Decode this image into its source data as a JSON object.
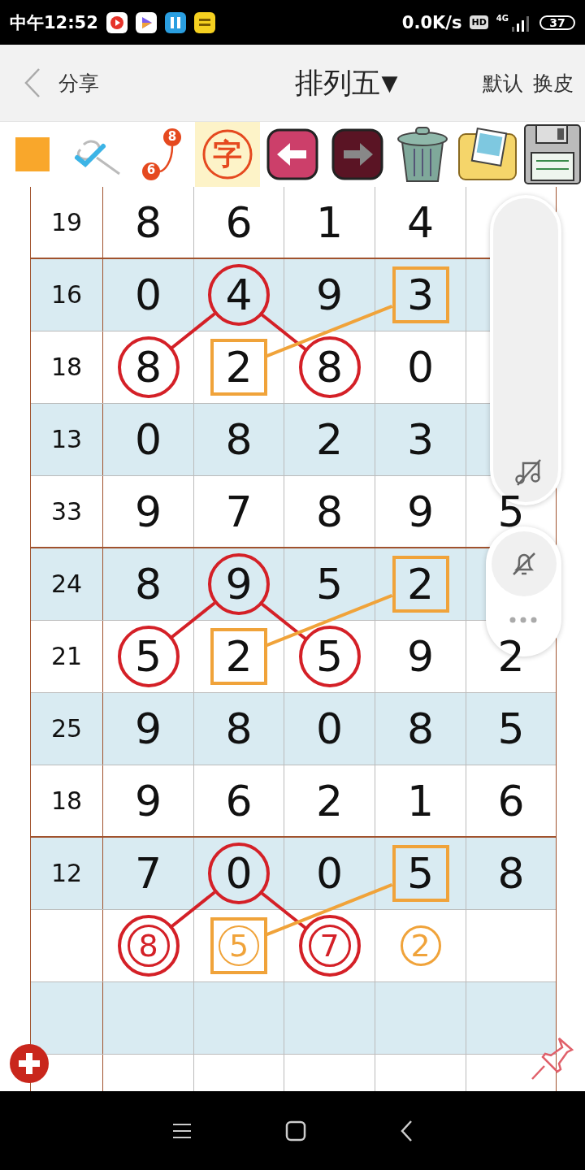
{
  "status_bar": {
    "time": "中午12:52",
    "speed": "0.0K/s",
    "hd": "HD",
    "network": "4G",
    "battery": "37"
  },
  "header": {
    "back_label": "分享",
    "title": "排列五",
    "title_glyph": "▼",
    "actions": [
      "默认",
      "换皮"
    ]
  },
  "tools": [
    {
      "kind": "color",
      "selected": false
    },
    {
      "kind": "check",
      "selected": false
    },
    {
      "kind": "link",
      "labels": [
        "6",
        "8"
      ],
      "selected": false
    },
    {
      "kind": "text",
      "label": "字",
      "selected": true
    },
    {
      "kind": "undo",
      "selected": false
    },
    {
      "kind": "redo",
      "selected": false
    },
    {
      "kind": "trash",
      "selected": false
    },
    {
      "kind": "gallery",
      "selected": false
    },
    {
      "kind": "save",
      "selected": false
    }
  ],
  "rows": [
    {
      "kind": "draw",
      "label": "19",
      "group_end": true,
      "cells": [
        {
          "value": "8",
          "circled": false,
          "boxed": false
        },
        {
          "value": "6",
          "circled": false,
          "boxed": false
        },
        {
          "value": "1",
          "circled": false,
          "boxed": false
        },
        {
          "value": "4",
          "circled": false,
          "boxed": false
        }
      ]
    },
    {
      "kind": "draw",
      "label": "16",
      "group_end": false,
      "cells": [
        {
          "value": "0",
          "circled": false,
          "boxed": false
        },
        {
          "value": "4",
          "circled": true,
          "boxed": false
        },
        {
          "value": "9",
          "circled": false,
          "boxed": false
        },
        {
          "value": "3",
          "circled": false,
          "boxed": true
        }
      ]
    },
    {
      "kind": "draw",
      "label": "18",
      "group_end": false,
      "cells": [
        {
          "value": "8",
          "circled": true,
          "boxed": false
        },
        {
          "value": "2",
          "circled": false,
          "boxed": true
        },
        {
          "value": "8",
          "circled": true,
          "boxed": false
        },
        {
          "value": "0",
          "circled": false,
          "boxed": false
        }
      ]
    },
    {
      "kind": "draw",
      "label": "13",
      "group_end": false,
      "cells": [
        {
          "value": "0",
          "circled": false,
          "boxed": false
        },
        {
          "value": "8",
          "circled": false,
          "boxed": false
        },
        {
          "value": "2",
          "circled": false,
          "boxed": false
        },
        {
          "value": "3",
          "circled": false,
          "boxed": false
        }
      ]
    },
    {
      "kind": "draw",
      "label": "33",
      "group_end": true,
      "cells": [
        {
          "value": "9",
          "circled": false,
          "boxed": false
        },
        {
          "value": "7",
          "circled": false,
          "boxed": false
        },
        {
          "value": "8",
          "circled": false,
          "boxed": false
        },
        {
          "value": "9",
          "circled": false,
          "boxed": false
        },
        {
          "value": "5",
          "circled": false,
          "boxed": false
        }
      ]
    },
    {
      "kind": "draw",
      "label": "24",
      "group_end": false,
      "cells": [
        {
          "value": "8",
          "circled": false,
          "boxed": false
        },
        {
          "value": "9",
          "circled": true,
          "boxed": false
        },
        {
          "value": "5",
          "circled": false,
          "boxed": false
        },
        {
          "value": "2",
          "circled": false,
          "boxed": true
        }
      ]
    },
    {
      "kind": "draw",
      "label": "21",
      "group_end": false,
      "cells": [
        {
          "value": "5",
          "circled": true,
          "boxed": false
        },
        {
          "value": "2",
          "circled": false,
          "boxed": true
        },
        {
          "value": "5",
          "circled": true,
          "boxed": false
        },
        {
          "value": "9",
          "circled": false,
          "boxed": false
        },
        {
          "value": "2",
          "circled": false,
          "boxed": false
        }
      ]
    },
    {
      "kind": "draw",
      "label": "25",
      "group_end": false,
      "cells": [
        {
          "value": "9",
          "circled": false,
          "boxed": false
        },
        {
          "value": "8",
          "circled": false,
          "boxed": false
        },
        {
          "value": "0",
          "circled": false,
          "boxed": false
        },
        {
          "value": "8",
          "circled": false,
          "boxed": false
        },
        {
          "value": "5",
          "circled": false,
          "boxed": false
        }
      ]
    },
    {
      "kind": "draw",
      "label": "18",
      "group_end": true,
      "cells": [
        {
          "value": "9",
          "circled": false,
          "boxed": false
        },
        {
          "value": "6",
          "circled": false,
          "boxed": false
        },
        {
          "value": "2",
          "circled": false,
          "boxed": false
        },
        {
          "value": "1",
          "circled": false,
          "boxed": false
        },
        {
          "value": "6",
          "circled": false,
          "boxed": false
        }
      ]
    },
    {
      "kind": "draw",
      "label": "12",
      "group_end": false,
      "cells": [
        {
          "value": "7",
          "circled": false,
          "boxed": false
        },
        {
          "value": "0",
          "circled": true,
          "boxed": false
        },
        {
          "value": "0",
          "circled": false,
          "boxed": false
        },
        {
          "value": "5",
          "circled": false,
          "boxed": true
        },
        {
          "value": "8",
          "circled": false,
          "boxed": false
        }
      ]
    },
    {
      "kind": "prediction",
      "group_end": false,
      "cells": [
        {
          "value": "8",
          "circled": true,
          "boxed": false
        },
        {
          "value": "5",
          "circled": false,
          "boxed": true
        },
        {
          "value": "7",
          "circled": true,
          "boxed": false
        },
        {
          "value": "2",
          "circled": false,
          "boxed": false
        }
      ]
    }
  ]
}
